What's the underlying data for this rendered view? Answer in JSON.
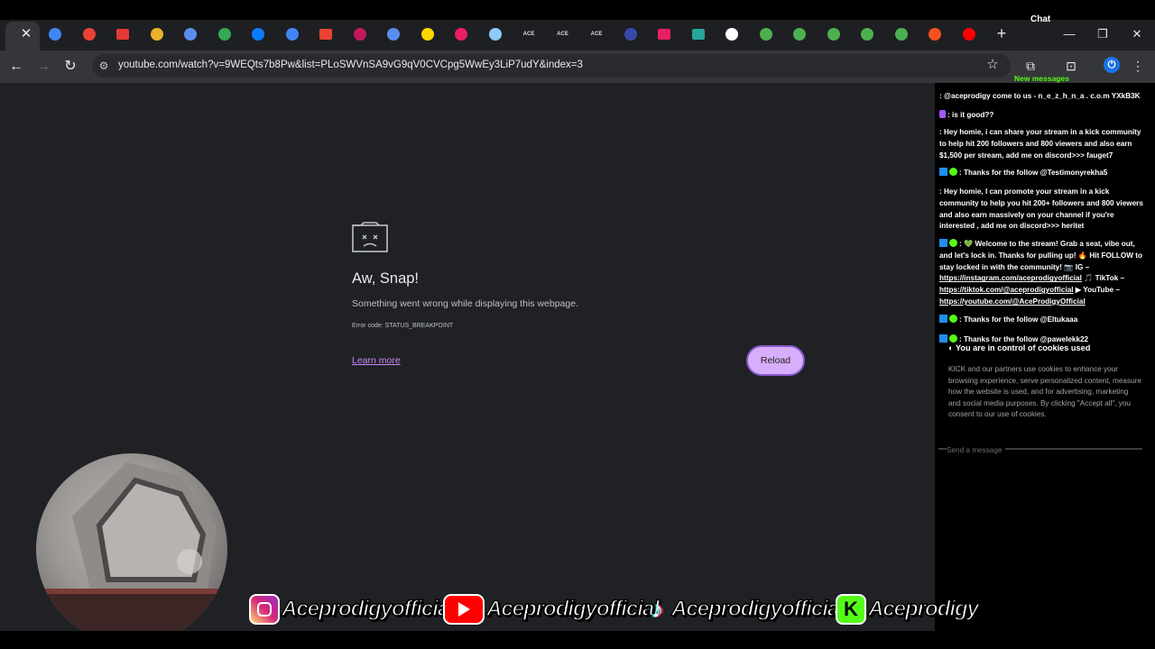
{
  "tabs": {
    "active_close": "✕",
    "new_tab": "+",
    "icons": [
      {
        "name": "docs-icon",
        "color": "#4285f4",
        "shape": "dot"
      },
      {
        "name": "tab-logo-icon",
        "color": "#ea4335",
        "shape": "dot"
      },
      {
        "name": "tab-red-icon",
        "color": "#e53935",
        "shape": "sq"
      },
      {
        "name": "slack-icon",
        "color": "#ecb22e",
        "shape": "dot"
      },
      {
        "name": "tab-triangle-icon",
        "color": "#5b8def",
        "shape": "dot"
      },
      {
        "name": "drive-icon",
        "color": "#34a853",
        "shape": "dot"
      },
      {
        "name": "meta-icon",
        "color": "#0a7cff",
        "shape": "dot"
      },
      {
        "name": "docs-icon",
        "color": "#4285f4",
        "shape": "dot"
      },
      {
        "name": "gmail-icon",
        "color": "#ea4335",
        "shape": "sq"
      },
      {
        "name": "tab-m-icon",
        "color": "#c2185b",
        "shape": "dot"
      },
      {
        "name": "tab-triangle-icon",
        "color": "#5b8def",
        "shape": "dot"
      },
      {
        "name": "tab-yellow-icon",
        "color": "#ffd600",
        "shape": "dot"
      },
      {
        "name": "tab-pink-icon",
        "color": "#e91e63",
        "shape": "dot"
      },
      {
        "name": "tab-v-icon",
        "color": "#90caf9",
        "shape": "dot"
      },
      {
        "name": "ace-icon",
        "label": "ACE"
      },
      {
        "name": "ace-icon",
        "label": "ACE"
      },
      {
        "name": "ace-icon",
        "label": "ACE"
      },
      {
        "name": "tab-circle-icon",
        "color": "#3949ab",
        "shape": "dot"
      },
      {
        "name": "tab-line-icon",
        "color": "#e91e63",
        "shape": "sq"
      },
      {
        "name": "tab-teal-icon",
        "color": "#26a69a",
        "shape": "sq"
      },
      {
        "name": "tab-dark-icon",
        "color": "#ffffff",
        "shape": "dot"
      },
      {
        "name": "plus-circle-icon",
        "color": "#4caf50",
        "shape": "dot"
      },
      {
        "name": "plus-circle-icon",
        "color": "#4caf50",
        "shape": "dot"
      },
      {
        "name": "plus-circle-icon",
        "color": "#4caf50",
        "shape": "dot"
      },
      {
        "name": "plus-circle-icon",
        "color": "#4caf50",
        "shape": "dot"
      },
      {
        "name": "plus-circle-icon",
        "color": "#4caf50",
        "shape": "dot"
      },
      {
        "name": "tab-s-icon",
        "color": "#f4511e",
        "shape": "dot"
      },
      {
        "name": "youtube-icon",
        "color": "#ff0000",
        "shape": "dot"
      }
    ]
  },
  "window": {
    "chat_label": "Chat",
    "minimize": "—",
    "maximize": "❐",
    "close": "✕"
  },
  "toolbar": {
    "back": "←",
    "forward": "→",
    "reload": "↻",
    "site_info": "⚙",
    "url": "youtube.com/watch?v=9WEQts7b8Pw&list=PLoSWVnSA9vG9qV0CVCpg5WwEy3LiP7udY&index=3",
    "bookmark": "☆",
    "extensions": "⧉",
    "cast": "⊡",
    "profile": "⏻",
    "menu": "⋮"
  },
  "error_page": {
    "title": "Aw, Snap!",
    "description": "Something went wrong while displaying this webpage.",
    "error_code": "Error code: STATUS_BREAKPOINT",
    "learn_more": "Learn more",
    "reload": "Reload"
  },
  "chat": {
    "new_messages": "New messages",
    "messages": [
      {
        "text": ": @aceprodigy come to us - n_e_z_h_n_a . c.o.m YXkB3K"
      },
      {
        "text": ": is it good??"
      },
      {
        "text": ": Hey homie, i can share your stream in a kick community to help hit 200 followers and 800 viewers and also earn $1,500 per stream, add me on discord>>> fauget7"
      },
      {
        "text": ": Thanks for the follow @Testimonyrekha5"
      },
      {
        "text": ": Hey homie, I can promote your stream in a kick community to help you hit 200+ followers and 800 viewers and also earn massively on your channel if you're interested , add me on discord>>> heritet"
      },
      {
        "text_a": ": 💚 Welcome to the stream! Grab a seat, vibe out, and let's lock in. Thanks for pulling up! 🔥 Hit FOLLOW to stay locked in with the community! 📷 IG –",
        "link1": "https://instagram.com/aceprodigyofficial",
        "text_b": " 🎵 TikTok –",
        "link2": "https://tiktok.com/@aceprodigyofficial",
        "text_c": " ▶ YouTube –",
        "link3": "https://youtube.com/@AceProdigyOfficial"
      },
      {
        "text": ": Thanks for the follow @Eltukaaa"
      },
      {
        "text": ": Thanks for the follow @pawelekk22"
      }
    ],
    "cookie_title": "You are in control of cookies used",
    "cookie_body": "KICK and our partners use cookies to enhance your browsing experience, serve personalized content, measure how the website is used, and for advertising, marketing and social media purposes. By clicking \"Accept all\", you consent to our use of cookies.",
    "send_placeholder": "Send a message"
  },
  "social": [
    {
      "platform": "instagram-icon",
      "handle": "Aceprodigyofficial"
    },
    {
      "platform": "youtube-icon",
      "handle": "Aceprodigyofficial"
    },
    {
      "platform": "tiktok-icon",
      "handle": "Aceprodigyofficial"
    },
    {
      "platform": "kick-icon",
      "handle": "Aceprodigy"
    }
  ]
}
